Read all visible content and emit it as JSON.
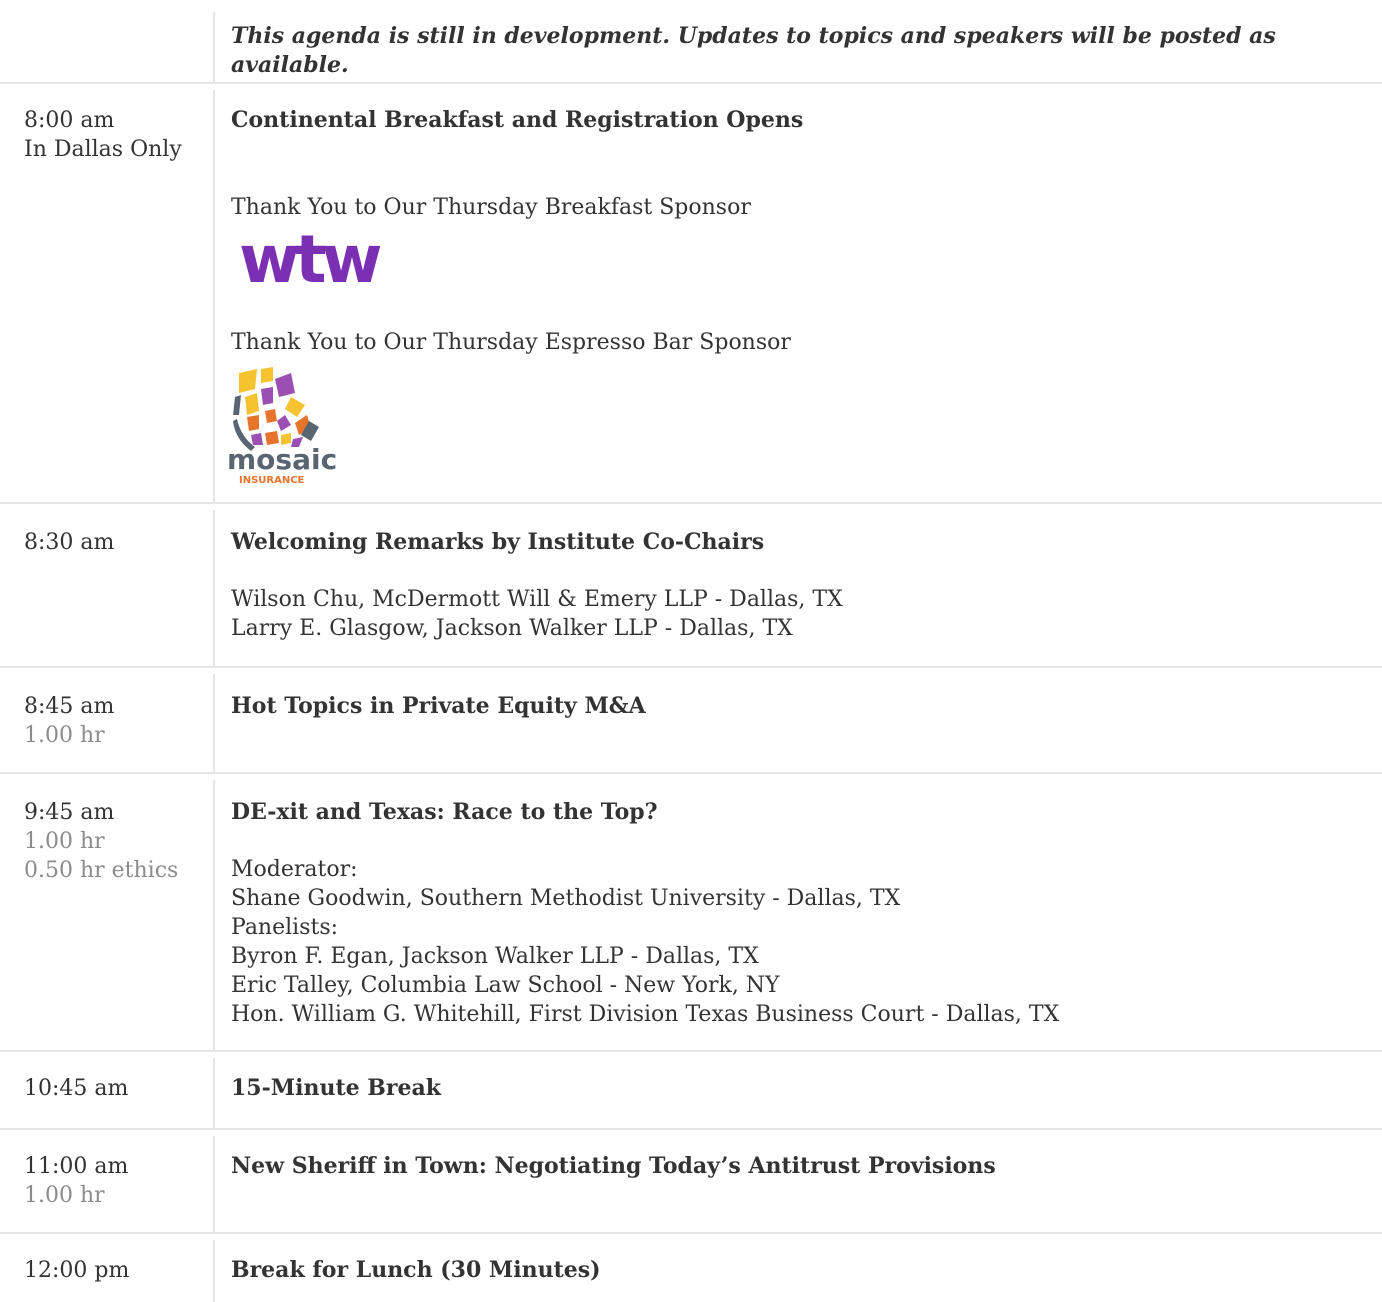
{
  "notice": "This agenda is still in development. Updates to topics and speakers will be posted as available.",
  "colors": {
    "text": "#333333",
    "muted": "#8c8c8c",
    "divider": "#e6e6e6",
    "wtw_purple": "#7b2fb3",
    "mosaic_gray": "#5a6572",
    "mosaic_orange": "#e8732a",
    "mosaic_yellow": "#f5c330",
    "mosaic_purple": "#9b4fb3"
  },
  "sessions": [
    {
      "time": "8:00 am",
      "location": "In Dallas Only",
      "title": "Continental Breakfast and Registration Opens",
      "sponsor_breakfast_label": "Thank You to Our Thursday Breakfast Sponsor",
      "sponsor_breakfast_logo": "wtw",
      "sponsor_espresso_label": "Thank You to Our Thursday Espresso Bar Sponsor",
      "sponsor_espresso_logo_word": "mosaic",
      "sponsor_espresso_logo_sub": "INSURANCE"
    },
    {
      "time": "8:30 am",
      "title": "Welcoming Remarks by Institute Co-Chairs",
      "speakers": [
        "Wilson Chu, McDermott Will & Emery LLP - Dallas, TX",
        "Larry E. Glasgow, Jackson Walker LLP - Dallas, TX"
      ]
    },
    {
      "time": "8:45 am",
      "credit": "1.00 hr",
      "title": "Hot Topics in Private Equity M&A"
    },
    {
      "time": "9:45 am",
      "credit": "1.00 hr",
      "ethics": "0.50 hr ethics",
      "title": "DE-xit and Texas: Race to the Top?",
      "moderator_label": "Moderator:",
      "moderator": "Shane Goodwin, Southern Methodist University - Dallas, TX",
      "panelists_label": "Panelists:",
      "panelists": [
        "Byron F. Egan, Jackson Walker LLP - Dallas, TX",
        "Eric Talley, Columbia Law School - New York, NY",
        "Hon. William G. Whitehill, First Division Texas Business Court - Dallas, TX"
      ]
    },
    {
      "time": "10:45 am",
      "title": "15-Minute Break"
    },
    {
      "time": "11:00 am",
      "credit": "1.00 hr",
      "title": "New Sheriff in Town: Negotiating Today’s Antitrust Provisions"
    },
    {
      "time": "12:00 pm",
      "title": "Break for Lunch (30 Minutes)"
    }
  ]
}
